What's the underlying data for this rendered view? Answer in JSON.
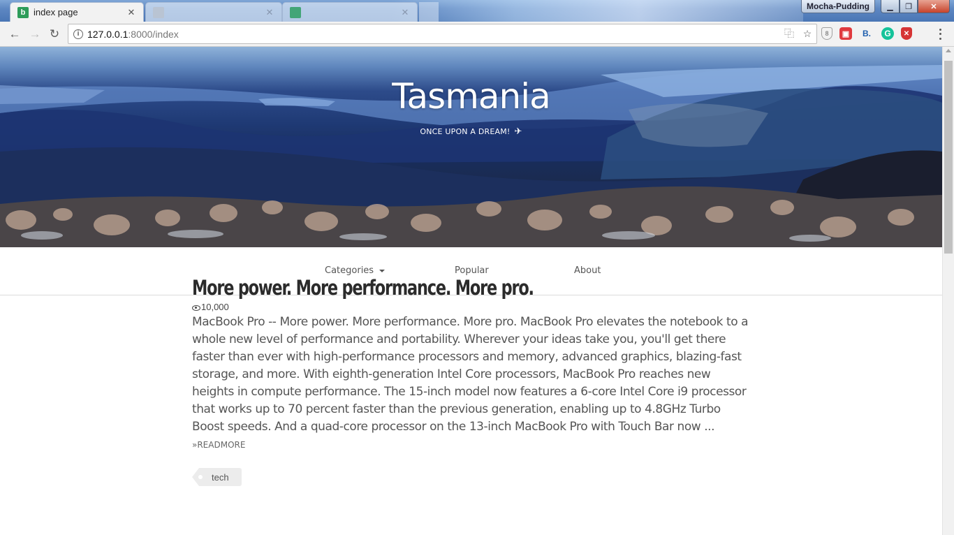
{
  "browser": {
    "tabs": [
      {
        "title": "index page",
        "favicon": "b",
        "active": true
      },
      {
        "title": "",
        "favicon": "",
        "active": false
      },
      {
        "title": "",
        "favicon": "",
        "active": false
      }
    ],
    "profile_name": "Mocha-Pudding",
    "url_host": "127.0.0.1",
    "url_path": ":8000/index",
    "extensions": [
      "shield-icon",
      "red-extension-icon",
      "bookmark-b-icon",
      "grammarly-icon",
      "ublock-icon"
    ]
  },
  "hero": {
    "title": "Tasmania",
    "subtitle": "ONCE UPON A DREAM!",
    "icon": "plane-icon"
  },
  "nav": {
    "categories": "Categories",
    "popular": "Popular",
    "about": "About"
  },
  "post": {
    "title": "More power. More performance. More pro.",
    "views": "10,000",
    "body": "MacBook Pro -- More power. More performance. More pro. MacBook Pro elevates the notebook to a whole new level of performance and portability. Wherever your ideas take you, you'll get there faster than ever with high-performance processors and memory, advanced graphics, blazing-fast storage, and more. With eighth-generation Intel Core processors, MacBook Pro reaches new heights in compute performance. The 15-inch model now features a 6-core Intel Core i9 processor that works up to 70 percent faster than the previous generation, enabling up to 4.8GHz Turbo Boost speeds. And a quad-core processor on the 13-inch MacBook Pro with Touch Bar now ...",
    "readmore": "»READMORE",
    "tag": "tech"
  }
}
